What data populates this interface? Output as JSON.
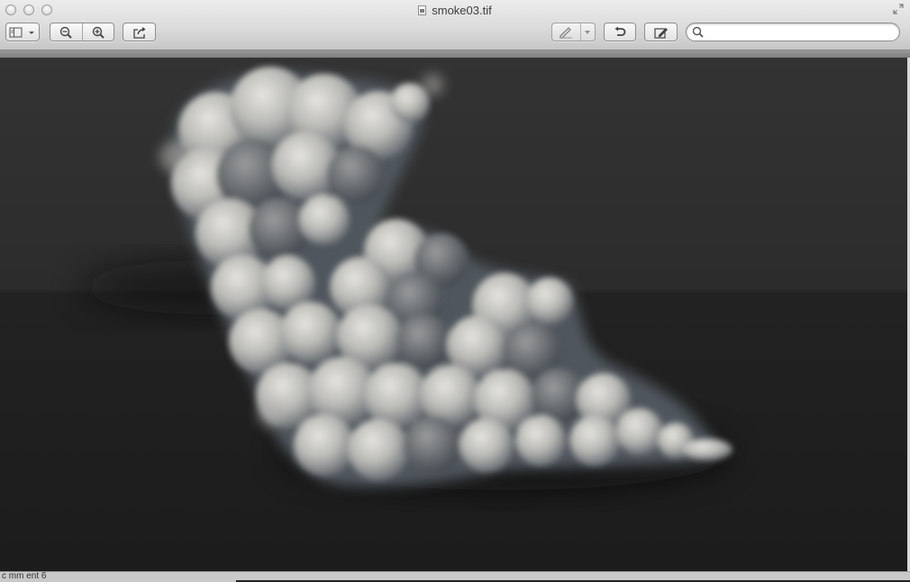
{
  "window": {
    "title": "smoke03.tif"
  },
  "toolbar": {
    "search_placeholder": ""
  },
  "image": {
    "subject": "smoke plume render on dark background"
  },
  "background_text": "c mm   ent 6",
  "colors": {
    "chrome": "#dcdcdc",
    "canvas_top": "#333333",
    "canvas_floor": "#1c1c1c",
    "smoke_light": "#d8d8d2",
    "smoke_shadow": "#4c5258"
  }
}
